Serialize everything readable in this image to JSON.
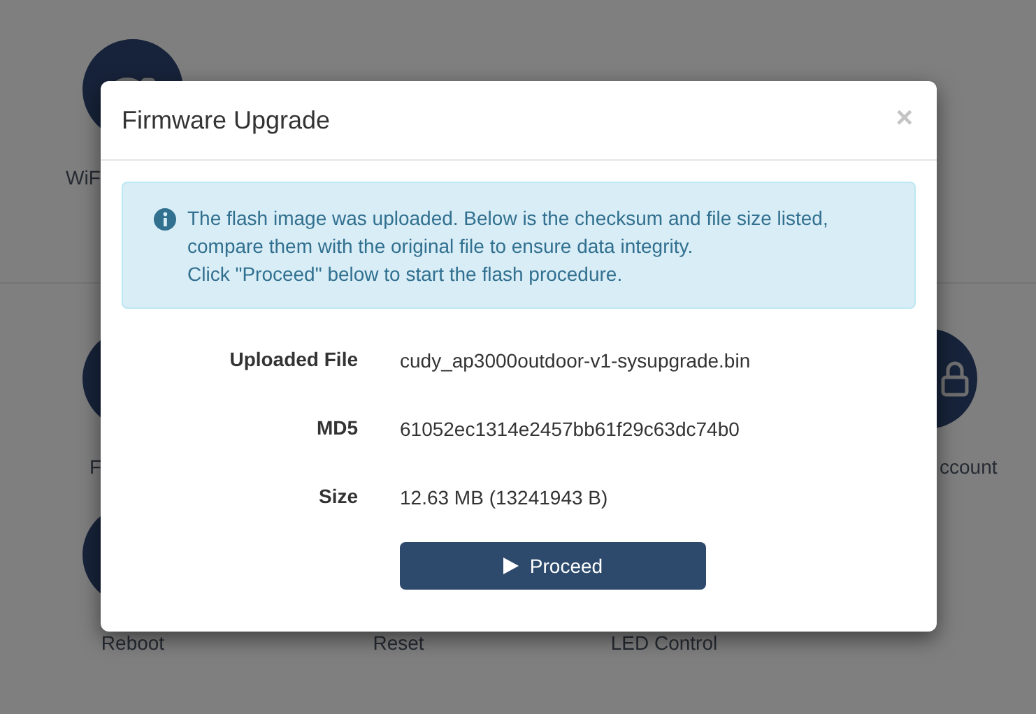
{
  "background": {
    "top_tiles": [
      {
        "label": "WiF",
        "kind": "wifi"
      }
    ],
    "bottom_tiles": [
      {
        "label": "F"
      },
      {
        "label": "ccount",
        "kind": "lock"
      },
      {
        "label": "Reboot"
      },
      {
        "label": "Reset"
      },
      {
        "label": "LED Control"
      }
    ]
  },
  "dialog": {
    "title": "Firmware Upgrade",
    "close": "×",
    "alert": {
      "lines": [
        "The flash image was uploaded. Below is the checksum and file size listed,",
        "compare them with the original file to ensure data integrity.",
        "Click \"Proceed\" below to start the flash procedure."
      ]
    },
    "fields": [
      {
        "label": "Uploaded File",
        "value": "cudy_ap3000outdoor-v1-sysupgrade.bin"
      },
      {
        "label": "MD5",
        "value": "61052ec1314e2457bb61f29c63dc74b0"
      },
      {
        "label": "Size",
        "value": "12.63 MB (13241943 B)"
      }
    ],
    "button": {
      "label": "Proceed"
    }
  }
}
